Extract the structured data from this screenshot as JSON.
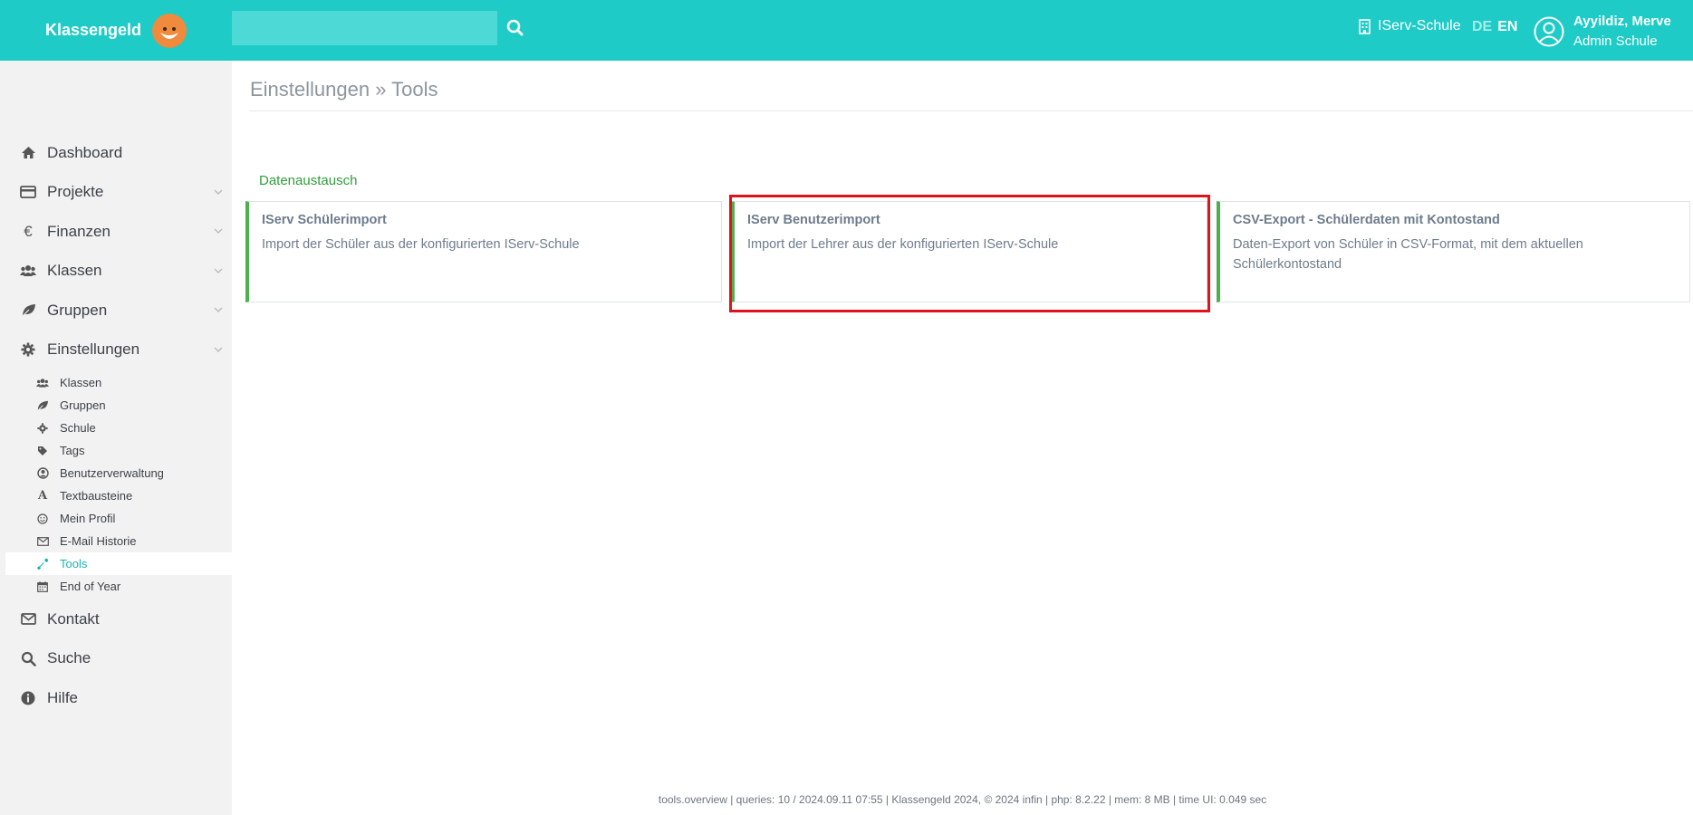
{
  "header": {
    "brand": "Klassengeld",
    "search": {
      "value": "",
      "placeholder": ""
    },
    "school": "IServ-Schule",
    "lang_de": "DE",
    "lang_en": "EN",
    "user_name": "Ayyildiz, Merve",
    "user_role": "Admin Schule",
    "accent_color": "#1ecbc6"
  },
  "sidebar": {
    "items": [
      {
        "label": "Dashboard",
        "icon": "home-icon"
      },
      {
        "label": "Projekte",
        "icon": "credit-card-icon"
      },
      {
        "label": "Finanzen",
        "icon": "euro-icon"
      },
      {
        "label": "Klassen",
        "icon": "users-icon"
      },
      {
        "label": "Gruppen",
        "icon": "leaf-icon"
      },
      {
        "label": "Einstellungen",
        "icon": "gear-icon"
      }
    ],
    "sub_items": [
      {
        "label": "Klassen",
        "icon": "users-icon"
      },
      {
        "label": "Gruppen",
        "icon": "leaf-icon"
      },
      {
        "label": "Schule",
        "icon": "gear-icon"
      },
      {
        "label": "Tags",
        "icon": "tag-icon"
      },
      {
        "label": "Benutzerverwaltung",
        "icon": "user-circle-icon"
      },
      {
        "label": "Textbausteine",
        "icon": "font-icon"
      },
      {
        "label": "Mein Profil",
        "icon": "smile-icon"
      },
      {
        "label": "E-Mail Historie",
        "icon": "envelope-icon"
      },
      {
        "label": "Tools",
        "icon": "wrench-icon",
        "active": true
      },
      {
        "label": "End of Year",
        "icon": "calendar-icon"
      }
    ],
    "bottom_items": [
      {
        "label": "Kontakt",
        "icon": "envelope-icon"
      },
      {
        "label": "Suche",
        "icon": "search-icon"
      },
      {
        "label": "Hilfe",
        "icon": "info-icon"
      }
    ]
  },
  "main": {
    "title": "Einstellungen » Tools",
    "section": "Datenaustausch",
    "cards": [
      {
        "title": "IServ Schülerimport",
        "description": "Import der Schüler aus der konfigurierten IServ-Schule"
      },
      {
        "title": "IServ Benutzerimport",
        "description": "Import der Lehrer aus der konfigurierten IServ-Schule"
      },
      {
        "title": "CSV-Export - Schülerdaten mit Kontostand",
        "description": "Daten-Export von Schüler in CSV-Format, mit dem aktuellen Schülerkontostand"
      }
    ]
  },
  "footer": "tools.overview | queries: 10 / 2024.09.11 07:55 | Klassengeld 2024, © 2024 infin | php: 8.2.22 | mem: 8 MB | time UI: 0.049 sec"
}
